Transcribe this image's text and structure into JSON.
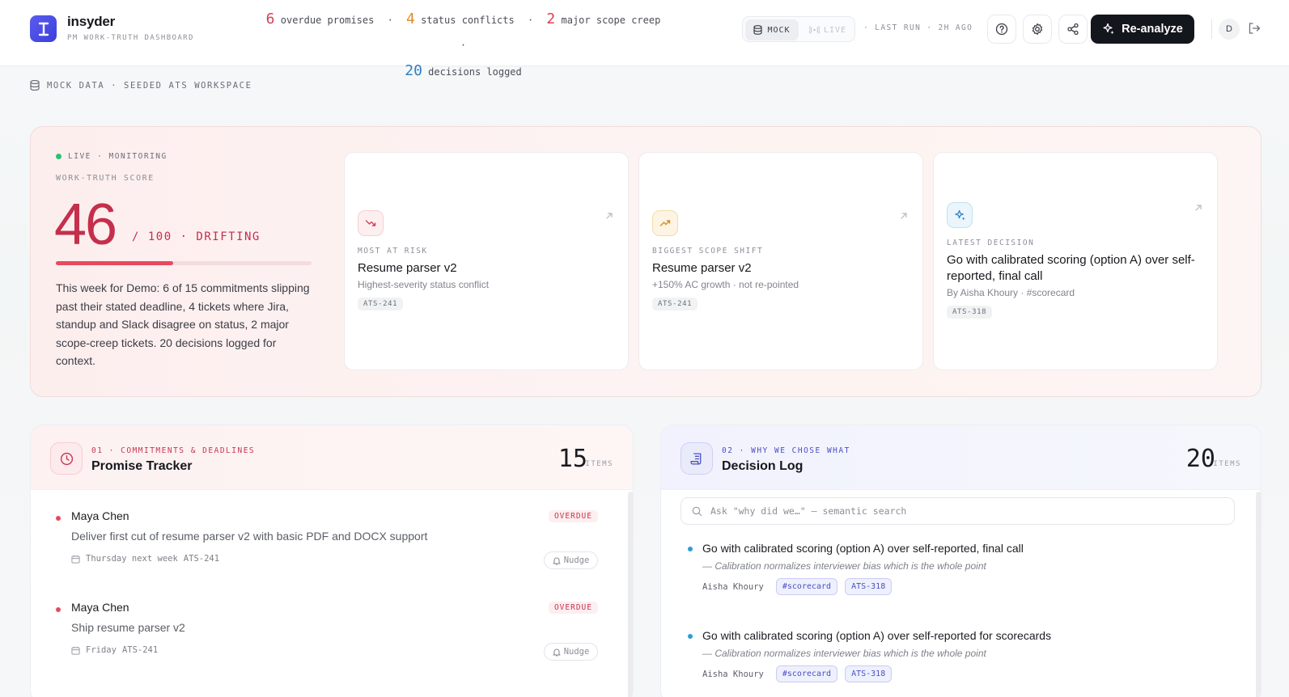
{
  "brand": {
    "name": "insyder",
    "subtitle": "PM WORK-TRUTH DASHBOARD"
  },
  "summary": {
    "overdue_count": "6",
    "overdue_label": "overdue promises",
    "conflicts_count": "4",
    "conflicts_label": "status conflicts",
    "scope_count": "2",
    "scope_label": "major scope creep",
    "decisions_count": "20",
    "decisions_label": "decisions logged",
    "separator": "·"
  },
  "mode_toggle": {
    "mock_label": "MOCK",
    "live_label": "LIVE"
  },
  "last_run": "· LAST RUN · 2H AGO",
  "actions": {
    "reanalyze_label": "Re-analyze",
    "avatar_initial": "D"
  },
  "data_source": "MOCK DATA · SEEDED ATS WORKSPACE",
  "hero": {
    "live_label": "LIVE · MONITORING",
    "score_label": "WORK-TRUTH SCORE",
    "score": "46",
    "score_suffix": "/ 100 · DRIFTING",
    "score_fraction": 0.46,
    "description": "This week for Demo: 6 of 15 commitments slipping past their stated deadline, 4 tickets where Jira, standup and Slack disagree on status, 2 major scope-creep tickets. 20 decisions logged for context."
  },
  "cards": [
    {
      "eyebrow": "MOST AT RISK",
      "title": "Resume parser v2",
      "subtitle": "Highest-severity status conflict",
      "tag": "ATS-241",
      "icon": "trending-down-icon"
    },
    {
      "eyebrow": "BIGGEST SCOPE SHIFT",
      "title": "Resume parser v2",
      "subtitle": "+150% AC growth · not re-pointed",
      "tag": "ATS-241",
      "icon": "trending-up-icon"
    },
    {
      "eyebrow": "LATEST DECISION",
      "title": "Go with calibrated scoring (option A) over self-reported, final call",
      "subtitle": "By Aisha Khoury · #scorecard",
      "tag": "ATS-318",
      "icon": "sparkle-icon"
    }
  ],
  "promise_tracker": {
    "eyebrow": "01 · COMMITMENTS & DEADLINES",
    "title": "Promise Tracker",
    "count": "15",
    "count_label": "ITEMS",
    "items": [
      {
        "owner": "Maya Chen",
        "text": "Deliver first cut of resume parser v2 with basic PDF and DOCX support",
        "due": "Thursday next week",
        "ticket": "ATS-241",
        "status": "OVERDUE",
        "action": "Nudge"
      },
      {
        "owner": "Maya Chen",
        "text": "Ship resume parser v2",
        "due": "Friday",
        "ticket": "ATS-241",
        "status": "OVERDUE",
        "action": "Nudge"
      }
    ]
  },
  "decision_log": {
    "eyebrow": "02 · WHY WE CHOSE WHAT",
    "title": "Decision Log",
    "count": "20",
    "count_label": "ITEMS",
    "search_placeholder": "Ask \"why did we…\" — semantic search",
    "items": [
      {
        "title": "Go with calibrated scoring (option A) over self-reported, final call",
        "reason": "— Calibration normalizes interviewer bias which is the whole point",
        "owner": "Aisha Khoury",
        "tag": "#scorecard",
        "ticket": "ATS-318"
      },
      {
        "title": "Go with calibrated scoring (option A) over self-reported for scorecards",
        "reason": "— Calibration normalizes interviewer bias which is the whole point",
        "owner": "Aisha Khoury",
        "tag": "#scorecard",
        "ticket": "ATS-318"
      }
    ]
  },
  "colors": {
    "danger": "#c42f4b",
    "accent": "#4b4fc4",
    "live": "#2fbf71",
    "primary_button": "#14161d"
  }
}
